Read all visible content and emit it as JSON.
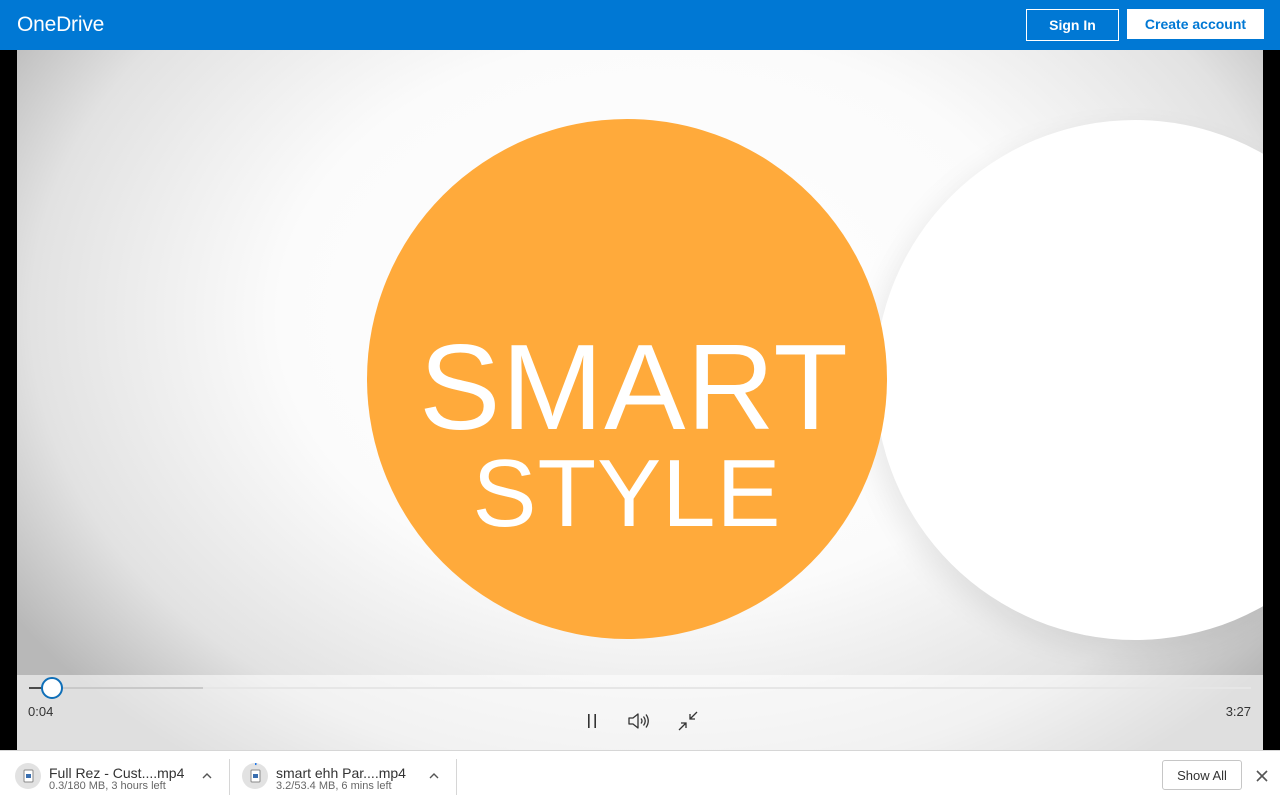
{
  "header": {
    "brand": "OneDrive",
    "sign_in_label": "Sign In",
    "create_account_label": "Create account",
    "brand_color": "#0078d4"
  },
  "video": {
    "title_line_1": "SMART",
    "title_line_2": "STYLE",
    "accent_color": "#ffaa3b"
  },
  "player": {
    "current_time": "0:04",
    "duration": "3:27",
    "progress_fraction": 0.019,
    "buffered_fraction": 0.14,
    "icons": [
      "pause-icon",
      "volume-icon",
      "exit-fullscreen-icon"
    ]
  },
  "downloads": {
    "items": [
      {
        "name": "Full Rez - Cust....mp4",
        "status": "0.3/180 MB, 3 hours left"
      },
      {
        "name": "smart ehh Par....mp4",
        "status": "3.2/53.4 MB, 6 mins left"
      }
    ],
    "show_all_label": "Show All"
  }
}
